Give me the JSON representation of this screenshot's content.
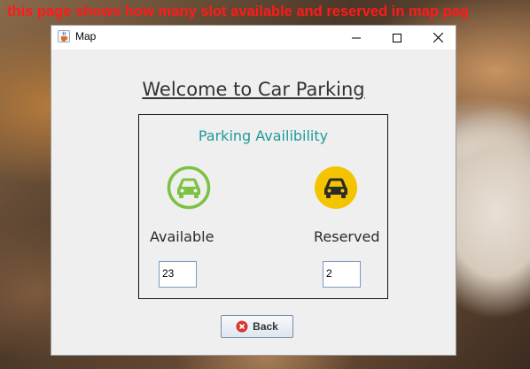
{
  "caption": "this page shows how many slot available  and reserved in map pag",
  "window": {
    "title": "Map",
    "icons": {
      "app": "java-cup-icon",
      "minimize": "minimize-icon",
      "maximize": "maximize-icon",
      "close": "close-icon"
    }
  },
  "main": {
    "heading": "Welcome to Car Parking",
    "panel_title": "Parking Availibility",
    "available": {
      "label": "Available",
      "value": "23",
      "icon": "car-icon",
      "color": "#7cc242"
    },
    "reserved": {
      "label": "Reserved",
      "value": "2",
      "icon": "car-icon",
      "color": "#f5c400"
    },
    "back_button": {
      "label": "Back",
      "icon": "cancel-icon",
      "icon_color": "#d9352b"
    }
  }
}
